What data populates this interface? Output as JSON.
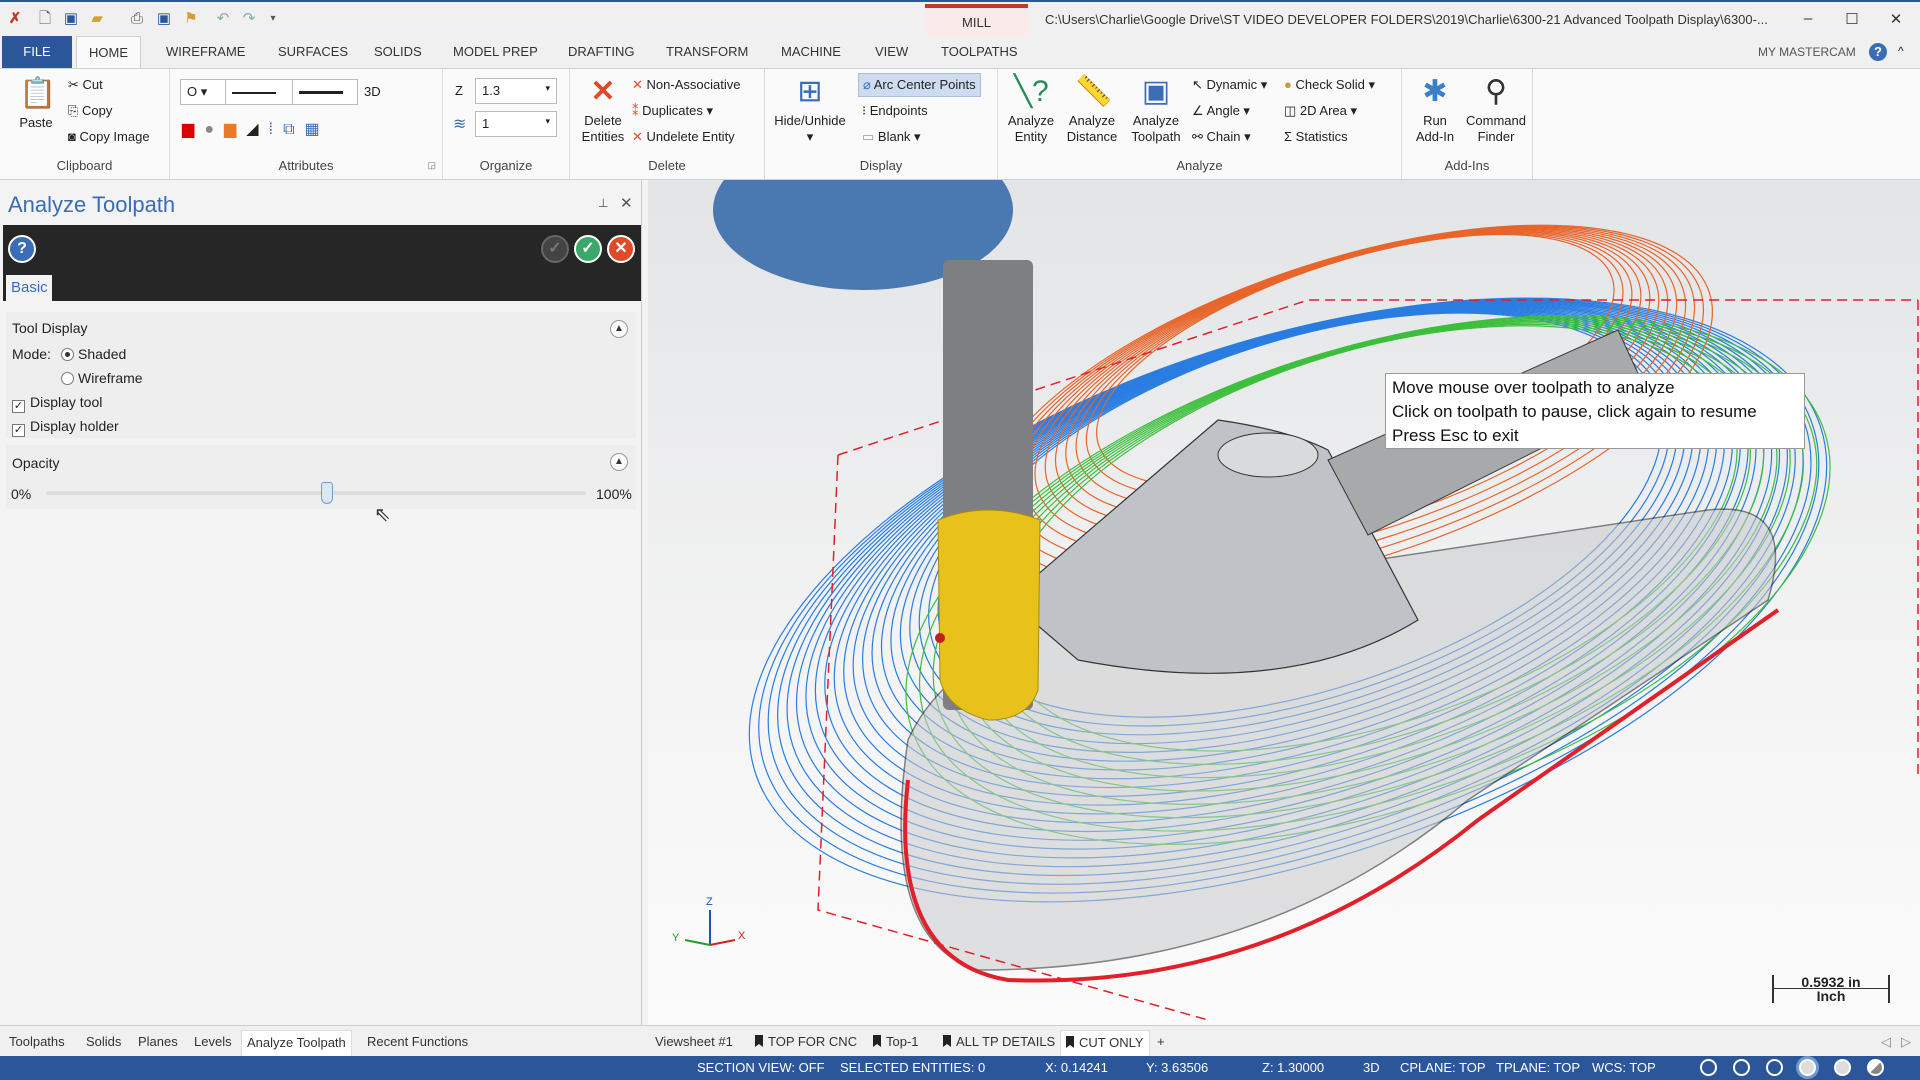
{
  "titlebar": {
    "quick_access_icons": [
      "mastercam-logo-icon",
      "new-icon",
      "save-icon",
      "open-icon",
      "print-icon",
      "save-as-icon",
      "folder-icon",
      "undo-icon",
      "redo-icon",
      "customize-icon"
    ],
    "context_tab": "MILL",
    "path": "C:\\Users\\Charlie\\Google Drive\\ST VIDEO DEVELOPER FOLDERS\\2019\\Charlie\\6300-21 Advanced Toolpath Display\\6300-...",
    "minimize": "–",
    "maximize": "☐",
    "close": "✕"
  },
  "tabs": [
    "FILE",
    "HOME",
    "WIREFRAME",
    "SURFACES",
    "SOLIDS",
    "MODEL PREP",
    "DRAFTING",
    "TRANSFORM",
    "MACHINE",
    "VIEW",
    "TOOLPATHS"
  ],
  "active_tab": "HOME",
  "my_mastercam": "MY MASTERCAM",
  "help": "?",
  "collapse": "^",
  "ribbon": {
    "clipboard": {
      "label": "Clipboard",
      "paste": "Paste",
      "cut": "Cut",
      "copy": "Copy",
      "copy_image": "Copy Image"
    },
    "attributes": {
      "label": "Attributes",
      "point_style": "O",
      "mode_3d": "3D"
    },
    "organize": {
      "label": "Organize",
      "z_label": "Z",
      "z_value": "1.3",
      "level_value": "1"
    },
    "delete": {
      "label": "Delete",
      "delete_entities": "Delete\nEntities",
      "non_associative": "Non-Associative",
      "duplicates": "Duplicates",
      "undelete_entity": "Undelete Entity"
    },
    "display": {
      "label": "Display",
      "hide_unhide": "Hide/Unhide",
      "arc_center_points": "Arc Center Points",
      "endpoints": "Endpoints",
      "blank": "Blank"
    },
    "analyze": {
      "label": "Analyze",
      "analyze_entity": "Analyze\nEntity",
      "analyze_distance": "Analyze\nDistance",
      "analyze_toolpath": "Analyze\nToolpath",
      "dynamic": "Dynamic",
      "angle": "Angle",
      "chain": "Chain",
      "check_solid": "Check Solid",
      "area_2d": "2D Area",
      "statistics": "Statistics"
    },
    "addins": {
      "label": "Add-Ins",
      "run_addin": "Run\nAdd-In",
      "command_finder": "Command\nFinder"
    }
  },
  "panel": {
    "title": "Analyze Toolpath",
    "pin": "⊥",
    "close": "✕",
    "help": "?",
    "tab": "Basic",
    "tool_display": {
      "heading": "Tool Display",
      "mode_label": "Mode:",
      "modes": [
        {
          "label": "Shaded",
          "selected": true
        },
        {
          "label": "Wireframe",
          "selected": false
        }
      ],
      "display_tool": {
        "label": "Display tool",
        "checked": true
      },
      "display_holder": {
        "label": "Display holder",
        "checked": true
      }
    },
    "opacity": {
      "heading": "Opacity",
      "min_label": "0%",
      "max_label": "100%",
      "value_percent": 52
    }
  },
  "viewport": {
    "tooltip": [
      "Move mouse over toolpath to analyze",
      "Click on toolpath to pause, click again to resume",
      "Press Esc to exit"
    ],
    "axes": {
      "x": "X",
      "y": "Y",
      "z": "Z"
    },
    "scale": {
      "value": "0.5932 in",
      "unit": "Inch"
    },
    "colors": {
      "toolpath_blue": "#2a7de1",
      "toolpath_orange": "#e8652a",
      "toolpath_green": "#3cbf3c",
      "boundary_red": "#e0202a",
      "tool_yellow": "#e8c21a",
      "holder_blue": "#4a78b0"
    }
  },
  "bottom_tabs": {
    "left": [
      "Toolpaths",
      "Solids",
      "Planes",
      "Levels",
      "Analyze Toolpath",
      "Recent Functions"
    ],
    "left_active": "Analyze Toolpath",
    "viewsheets": [
      "Viewsheet #1",
      "TOP FOR CNC",
      "Top-1",
      "ALL TP DETAILS",
      "CUT ONLY"
    ],
    "viewsheet_active": "CUT ONLY",
    "add": "+"
  },
  "status": {
    "section_view": "SECTION VIEW: OFF",
    "selected": "SELECTED ENTITIES: 0",
    "x": "X:  0.14241",
    "y": "Y:  3.63506",
    "z": "Z:  1.30000",
    "mode": "3D",
    "cplane": "CPLANE: TOP",
    "tplane": "TPLANE: TOP",
    "wcs": "WCS: TOP"
  }
}
